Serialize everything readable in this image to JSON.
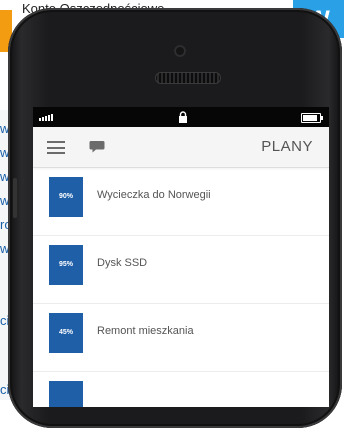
{
  "background": {
    "top_text": "Konto Oszczędnościowe",
    "badge_letter": "W",
    "left_letters": [
      "w",
      "w",
      "w",
      "w",
      "ro",
      "w",
      "ci",
      "ci"
    ]
  },
  "screen": {
    "header": {
      "title": "PLANY",
      "menu_icon": "hamburger-icon",
      "chat_icon": "speech-bubble-icon"
    },
    "plans": [
      {
        "name": "Wycieczka do Norwegii",
        "progress": "90%"
      },
      {
        "name": "Dysk SSD",
        "progress": "95%"
      },
      {
        "name": "Remont mieszkania",
        "progress": "45%"
      },
      {
        "name": "",
        "progress": ""
      }
    ]
  },
  "colors": {
    "accent": "#1e5fa8",
    "badge_bg": "#2aa1e6",
    "orange": "#f39c12"
  }
}
